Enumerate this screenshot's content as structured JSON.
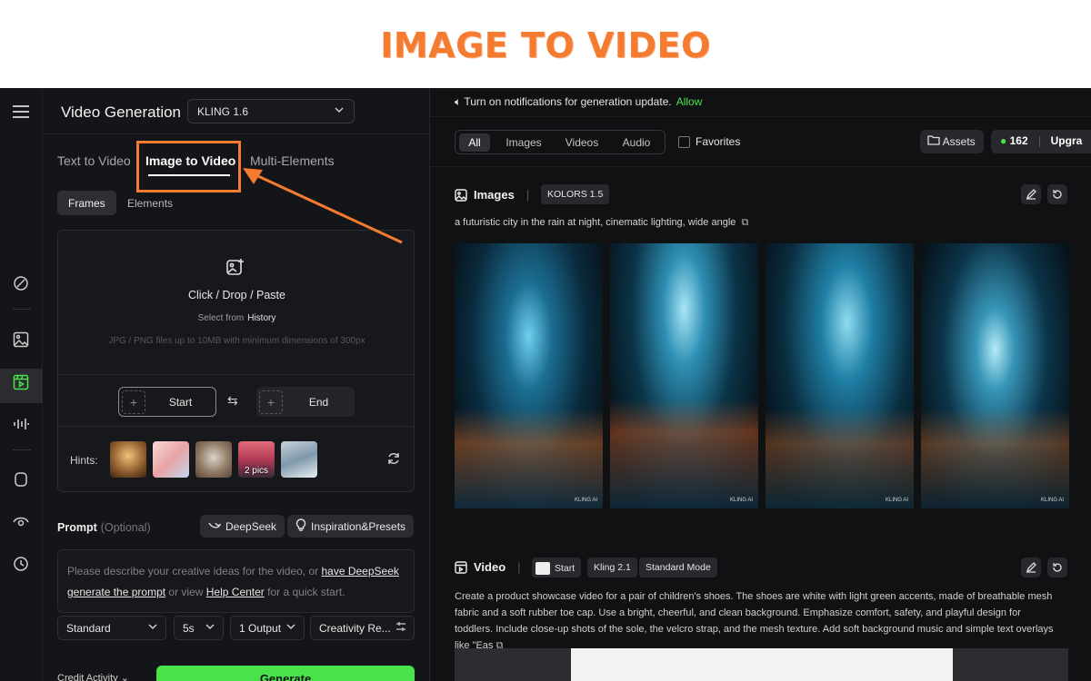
{
  "banner": {
    "title": "IMAGE TO VIDEO",
    "color": "#f47b30"
  },
  "left": {
    "title": "Video Generation",
    "model": "KLING 1.6",
    "tabs": [
      {
        "label": "Text to Video"
      },
      {
        "label": "Image to Video"
      },
      {
        "label": "Multi-Elements"
      }
    ],
    "subtabs": [
      "Frames",
      "Elements"
    ],
    "upload": {
      "action": "Click / Drop / Paste",
      "select_prefix": "Select from",
      "select_link": "History",
      "note": "JPG / PNG files up to 10MB with minimum dimensions of 300px"
    },
    "frames": {
      "start": "Start",
      "end": "End"
    },
    "hints": {
      "label": "Hints:",
      "more": "2 pics"
    },
    "prompt": {
      "label": "Prompt",
      "optional": "(Optional)",
      "deepseek": "DeepSeek",
      "inspiration": "Inspiration&Presets",
      "ph_1": "Please describe your creative ideas for the video, or ",
      "ph_link1": "have DeepSeek generate the prompt",
      "ph_2": " or view ",
      "ph_link2": "Help Center",
      "ph_3": " for a quick start."
    },
    "settings": {
      "mode": "Standard",
      "duration": "5s",
      "outputs": "1 Output",
      "creativity": "Creativity Re..."
    },
    "credit": "Credit Activity",
    "generate": "Generate",
    "accent": "#4ae24a"
  },
  "right": {
    "notification": "Turn on notifications for generation update.",
    "allow": "Allow",
    "filters": [
      "All",
      "Images",
      "Videos",
      "Audio"
    ],
    "favorites": "Favorites",
    "assets": "Assets",
    "credits": "162",
    "upgrade": "Upgra",
    "images_section": {
      "title": "Images",
      "model_tag": "KOLORS 1.5",
      "prompt": "a futuristic city in the rain at night, cinematic lighting, wide angle",
      "watermark": "KLING AI"
    },
    "video_section": {
      "title": "Video",
      "tags": [
        "Start",
        "Kling 2.1",
        "Standard Mode"
      ],
      "description": "Create a product showcase video for a pair of children's shoes. The shoes are white with light green accents, made of breathable mesh fabric and a soft rubber toe cap. Use a bright, cheerful, and clean background. Emphasize comfort, safety, and playful design for toddlers. Include close-up shots of the sole, the velcro strap, and the mesh texture. Add soft background music and simple text overlays like \"Eas"
    }
  }
}
